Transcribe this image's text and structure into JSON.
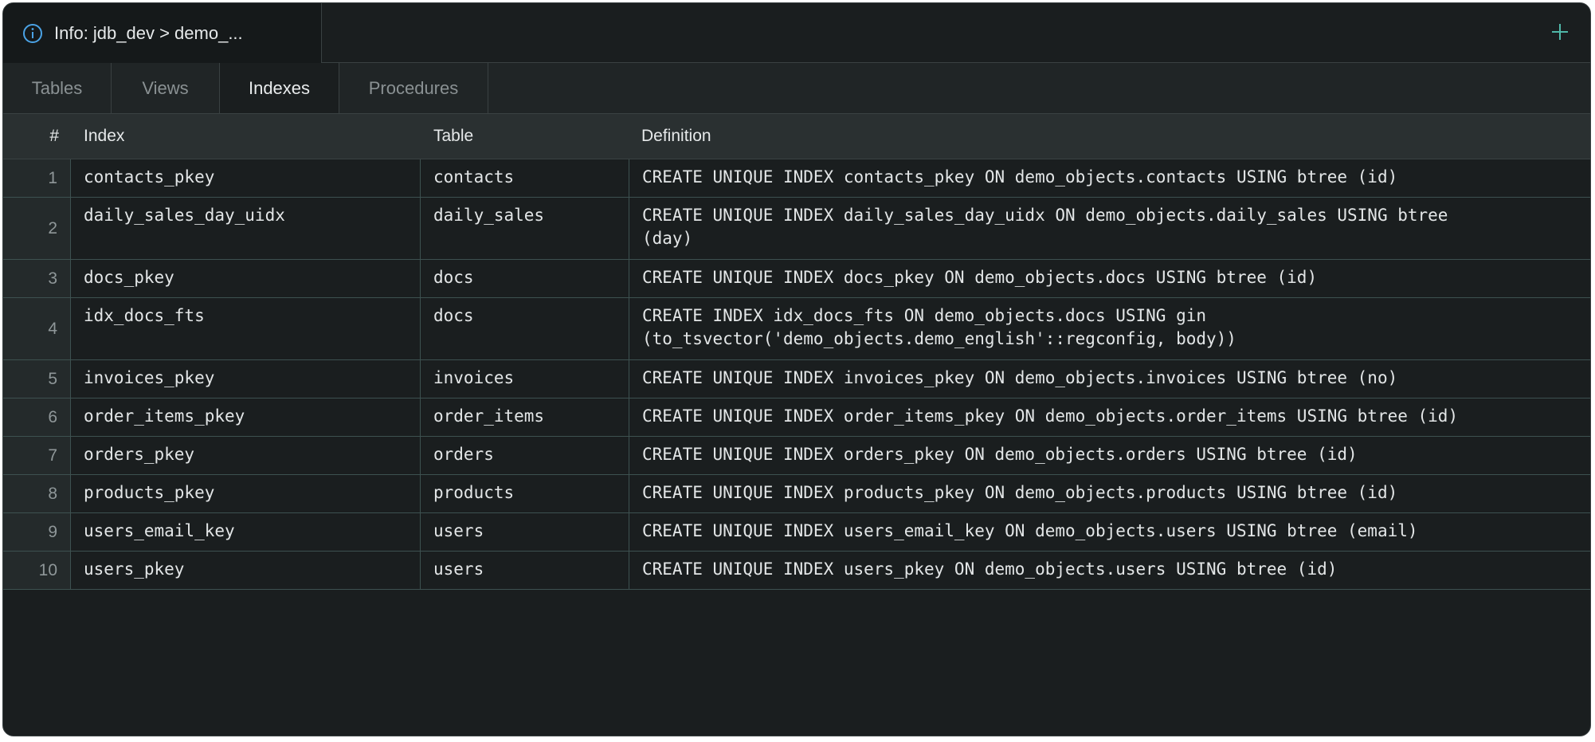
{
  "window": {
    "tab_title": "Info: jdb_dev > demo_...",
    "tab_icon": "info-icon",
    "add_icon": "plus-icon",
    "accent": "#4fb8a8",
    "info_color": "#4ba3e6"
  },
  "subtabs": [
    "Tables",
    "Views",
    "Indexes",
    "Procedures"
  ],
  "active_subtab": "Indexes",
  "grid": {
    "columns": {
      "num": "#",
      "index": "Index",
      "table": "Table",
      "definition": "Definition"
    },
    "rows": [
      {
        "num": "1",
        "index": "contacts_pkey",
        "table": "contacts",
        "definition": "CREATE UNIQUE INDEX contacts_pkey ON demo_objects.contacts USING btree (id)"
      },
      {
        "num": "2",
        "index": "daily_sales_day_uidx",
        "table": "daily_sales",
        "definition": "CREATE UNIQUE INDEX daily_sales_day_uidx ON demo_objects.daily_sales USING btree\n(day)"
      },
      {
        "num": "3",
        "index": "docs_pkey",
        "table": "docs",
        "definition": "CREATE UNIQUE INDEX docs_pkey ON demo_objects.docs USING btree (id)"
      },
      {
        "num": "4",
        "index": "idx_docs_fts",
        "table": "docs",
        "definition": "CREATE INDEX idx_docs_fts ON demo_objects.docs USING gin\n(to_tsvector('demo_objects.demo_english'::regconfig, body))"
      },
      {
        "num": "5",
        "index": "invoices_pkey",
        "table": "invoices",
        "definition": "CREATE UNIQUE INDEX invoices_pkey ON demo_objects.invoices USING btree (no)"
      },
      {
        "num": "6",
        "index": "order_items_pkey",
        "table": "order_items",
        "definition": "CREATE UNIQUE INDEX order_items_pkey ON demo_objects.order_items USING btree (id)"
      },
      {
        "num": "7",
        "index": "orders_pkey",
        "table": "orders",
        "definition": "CREATE UNIQUE INDEX orders_pkey ON demo_objects.orders USING btree (id)"
      },
      {
        "num": "8",
        "index": "products_pkey",
        "table": "products",
        "definition": "CREATE UNIQUE INDEX products_pkey ON demo_objects.products USING btree (id)"
      },
      {
        "num": "9",
        "index": "users_email_key",
        "table": "users",
        "definition": "CREATE UNIQUE INDEX users_email_key ON demo_objects.users USING btree (email)"
      },
      {
        "num": "10",
        "index": "users_pkey",
        "table": "users",
        "definition": "CREATE UNIQUE INDEX users_pkey ON demo_objects.users USING btree (id)"
      }
    ]
  }
}
